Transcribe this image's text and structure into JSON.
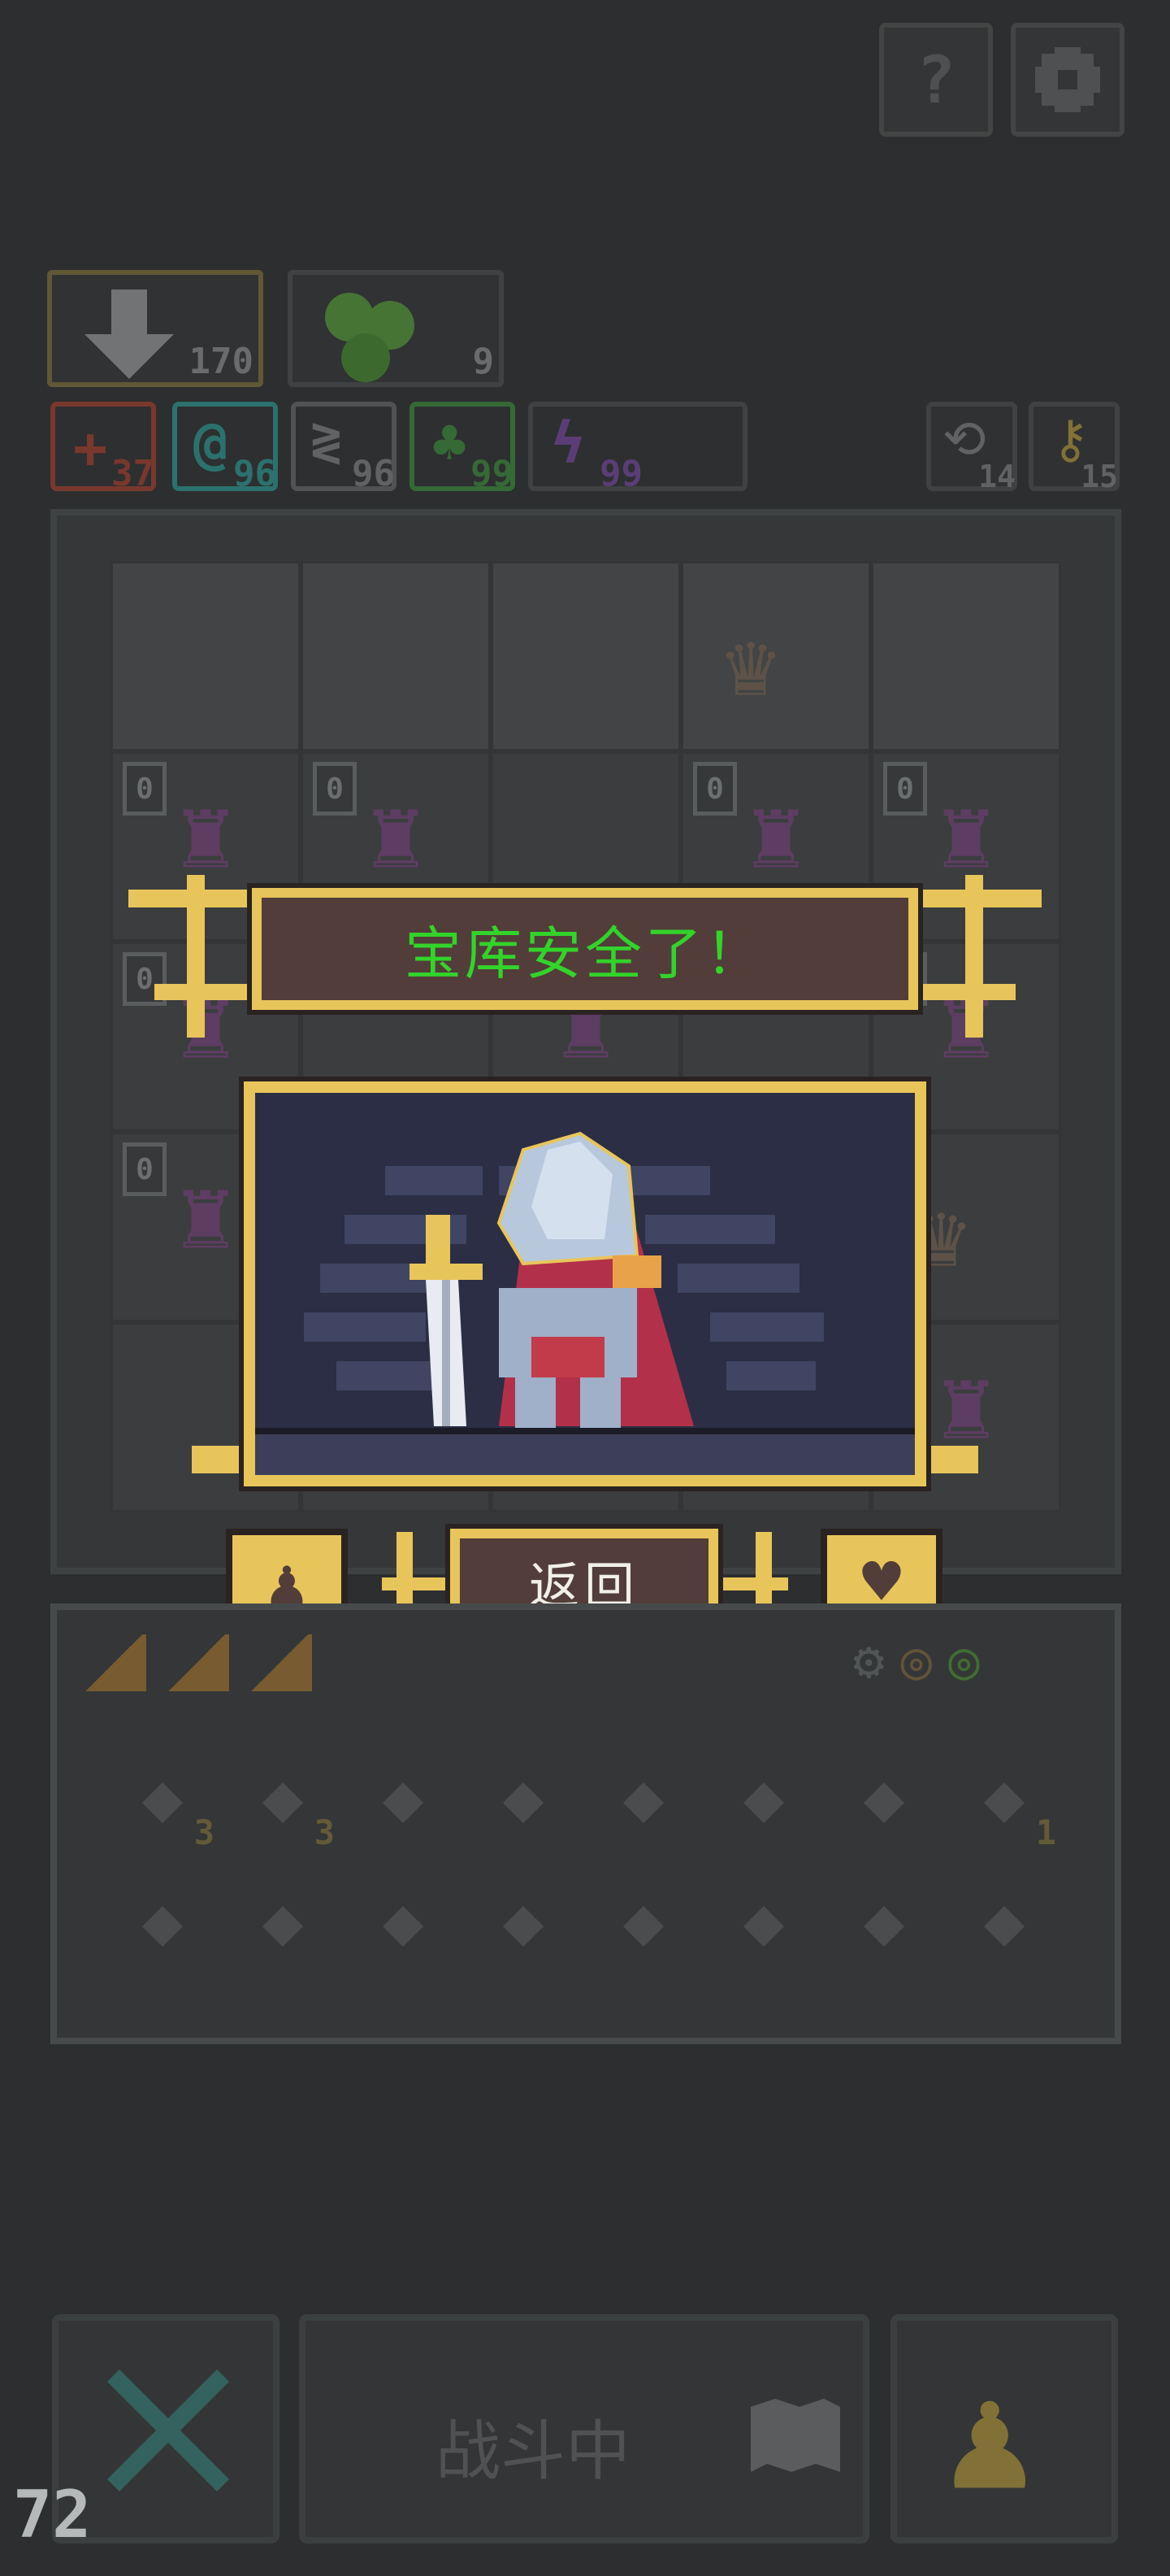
{
  "top_buttons": {
    "help_label": "?",
    "settings_icon": "gear-icon"
  },
  "resources": {
    "armor": {
      "icon": "shield-down-icon",
      "value": "170"
    },
    "herb": {
      "icon": "herb-cluster-icon",
      "value": "9"
    }
  },
  "stats": [
    {
      "icon": "plus-icon",
      "value": "37",
      "color": "#b8412c"
    },
    {
      "icon": "swirl-icon",
      "value": "96",
      "color": "#2aa8a0"
    },
    {
      "icon": "wing-icon",
      "value": "96",
      "color": "#8a8d8e"
    },
    {
      "icon": "leaf-icon",
      "value": "99",
      "color": "#3c9a3c"
    },
    {
      "icon": "lightning-icon",
      "value": "99",
      "color": "#7f4ab0"
    }
  ],
  "counters": {
    "refresh": "14",
    "key": "15"
  },
  "board": {
    "level_badge": "0",
    "cells": [
      [
        "",
        "",
        "",
        "crystal",
        ""
      ],
      [
        "goblin",
        "goblin",
        "",
        "goblin",
        "goblin"
      ],
      [
        "goblin",
        "",
        "goblin",
        "",
        "goblin"
      ],
      [
        "goblin",
        "",
        "",
        "",
        "crystal"
      ],
      [
        "",
        "",
        "",
        "",
        "goblin"
      ]
    ]
  },
  "modal": {
    "title": "宝库安全了！",
    "return_label": "返回",
    "left_icon": "pawn-icon",
    "right_icon": "heart-shield-icon"
  },
  "inventory": {
    "row1": [
      {
        "icon": "heart-gem-icon",
        "count": "3"
      },
      {
        "icon": "scroll-icon",
        "count": "3"
      },
      {
        "icon": "hammer-icon",
        "count": ""
      },
      {
        "icon": "axe-icon",
        "count": ""
      },
      {
        "icon": "chalice-icon",
        "count": ""
      },
      {
        "icon": "arrow-icon",
        "count": ""
      },
      {
        "icon": "potion-icon",
        "count": ""
      },
      {
        "icon": "jar-icon",
        "count": "1"
      }
    ],
    "row2": [
      {
        "icon": "green-arrow-icon"
      },
      {
        "icon": "purple-swirl-icon"
      },
      {
        "icon": "blue-swirl-icon"
      },
      {
        "icon": "castle-card-icon"
      },
      {
        "icon": "rose-card-icon"
      },
      {
        "icon": "blue-flame-card-icon"
      },
      {
        "icon": "gear-star-icon"
      },
      {
        "icon": "bat-icon"
      }
    ]
  },
  "bottom": {
    "cancel_icon": "x-icon",
    "battle_label": "战斗中",
    "map_icon": "map-icon",
    "pawn_icon": "pawn-icon",
    "fps": "72"
  }
}
